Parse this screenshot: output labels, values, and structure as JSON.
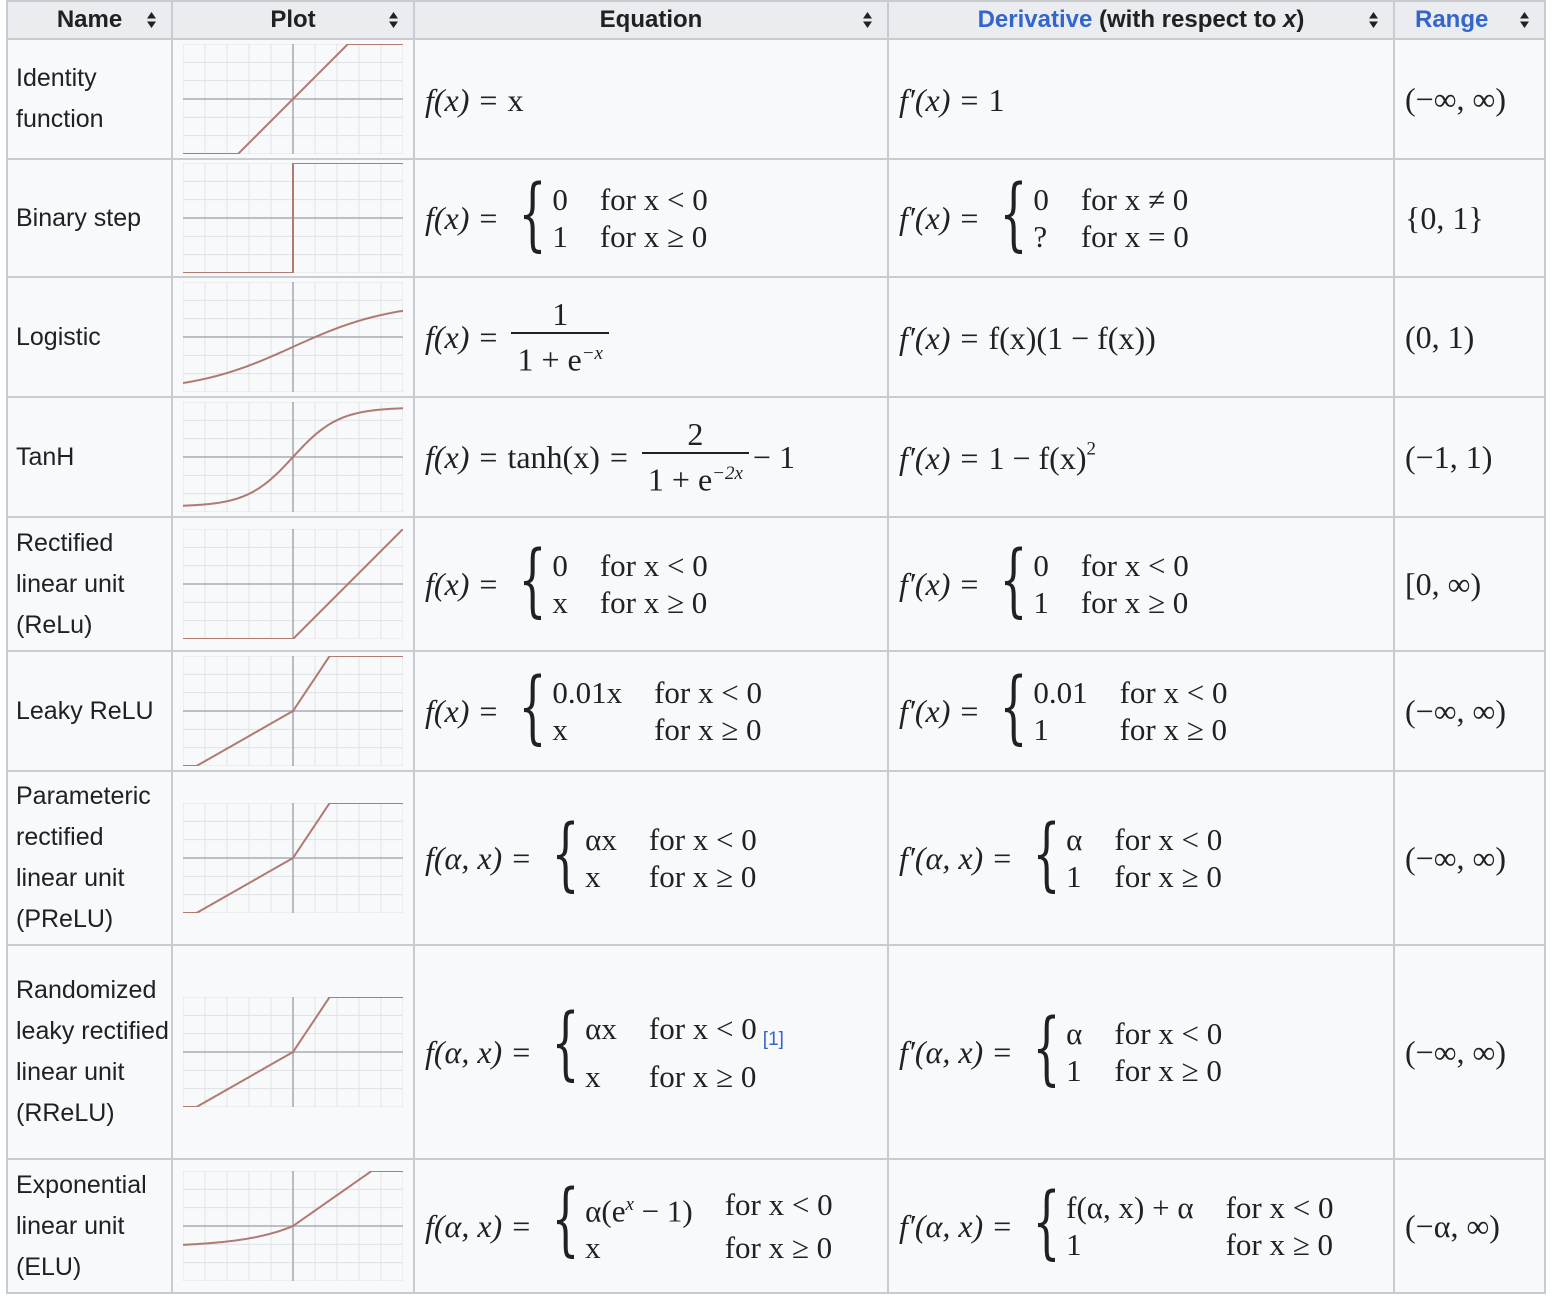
{
  "header": {
    "name": "Name",
    "plot": "Plot",
    "equation": "Equation",
    "derivative_link": "Derivative",
    "derivative_rest": " (with respect to ",
    "derivative_var": "x",
    "derivative_close": ")",
    "range": "Range"
  },
  "colors": {
    "link": "#3366cc",
    "curve": "#b07a72",
    "grid": "#dfe2e6",
    "axis": "#a8acb3",
    "header_bg": "#eaecf0",
    "cell_bg": "#f8f9fa"
  },
  "ref": "[1]",
  "rows": [
    {
      "name": "Identity function",
      "plot": "identity",
      "equation": {
        "lhs": "f(x)",
        "rhs": "x"
      },
      "derivative": {
        "lhs": "f′(x)",
        "rhs": "1"
      },
      "range": "(−∞, ∞)"
    },
    {
      "name": "Binary step",
      "plot": "binary-step",
      "equation": {
        "lhs": "f(x)",
        "cases": [
          [
            "0",
            "for x < 0"
          ],
          [
            "1",
            "for x ≥ 0"
          ]
        ]
      },
      "derivative": {
        "lhs": "f′(x)",
        "cases": [
          [
            "0",
            "for x ≠ 0"
          ],
          [
            "?",
            "for x = 0"
          ]
        ]
      },
      "range": "{0, 1}"
    },
    {
      "name": "Logistic",
      "plot": "logistic",
      "equation": {
        "lhs": "f(x)",
        "num": "1",
        "den": "1 + e",
        "den_sup": "−x"
      },
      "derivative": {
        "lhs": "f′(x)",
        "rhs": "f(x)(1 − f(x))"
      },
      "range": "(0, 1)"
    },
    {
      "name": "TanH",
      "plot": "tanh",
      "equation": {
        "lhs": "f(x)",
        "mid": "tanh(x)",
        "num": "2",
        "den": "1 + e",
        "den_sup": "−2x",
        "trail": "− 1"
      },
      "derivative": {
        "lhs": "f′(x)",
        "rhs": "1 − f(x)",
        "rhs_sup": "2"
      },
      "range": "(−1, 1)"
    },
    {
      "name": "Rectified linear unit (ReLu)",
      "plot": "relu",
      "equation": {
        "lhs": "f(x)",
        "cases": [
          [
            "0",
            "for x < 0"
          ],
          [
            "x",
            "for x ≥ 0"
          ]
        ]
      },
      "derivative": {
        "lhs": "f′(x)",
        "cases": [
          [
            "0",
            "for x < 0"
          ],
          [
            "1",
            "for x ≥ 0"
          ]
        ]
      },
      "range": "[0, ∞)"
    },
    {
      "name": "Leaky ReLU",
      "plot": "leaky",
      "equation": {
        "lhs": "f(x)",
        "cases": [
          [
            "0.01x",
            "for x < 0"
          ],
          [
            "x",
            "for x ≥ 0"
          ]
        ]
      },
      "derivative": {
        "lhs": "f′(x)",
        "cases": [
          [
            "0.01",
            "for x < 0"
          ],
          [
            "1",
            "for x ≥ 0"
          ]
        ]
      },
      "range": "(−∞, ∞)"
    },
    {
      "name": "Parameteric rectified linear unit (PReLU)",
      "plot": "prelu",
      "equation": {
        "lhs": "f(α, x)",
        "cases": [
          [
            "αx",
            "for x < 0"
          ],
          [
            "x",
            "for x ≥ 0"
          ]
        ]
      },
      "derivative": {
        "lhs": "f′(α, x)",
        "cases": [
          [
            "α",
            "for x < 0"
          ],
          [
            "1",
            "for x ≥ 0"
          ]
        ]
      },
      "range": "(−∞, ∞)"
    },
    {
      "name": "Randomized leaky rectified linear unit (RReLU)",
      "plot": "rrelu",
      "equation": {
        "lhs": "f(α, x)",
        "cases": [
          [
            "αx",
            "for x < 0"
          ],
          [
            "x",
            "for x ≥ 0"
          ]
        ]
      },
      "derivative": {
        "lhs": "f′(α, x)",
        "cases": [
          [
            "α",
            "for x < 0"
          ],
          [
            "1",
            "for x ≥ 0"
          ]
        ]
      },
      "range": "(−∞, ∞)"
    },
    {
      "name": "Exponential linear unit (ELU)",
      "plot": "elu",
      "equation": {
        "lhs": "f(α, x)",
        "cases": [
          [
            "α(e",
            "for x < 0"
          ],
          [
            "x",
            "for x ≥ 0"
          ]
        ],
        "first_sup": "x",
        "first_tail": " − 1)"
      },
      "derivative": {
        "lhs": "f′(α, x)",
        "cases": [
          [
            "f(α, x) + α",
            "for x < 0"
          ],
          [
            "1",
            "for x ≥ 0"
          ]
        ]
      },
      "range": "(−α, ∞)"
    }
  ]
}
